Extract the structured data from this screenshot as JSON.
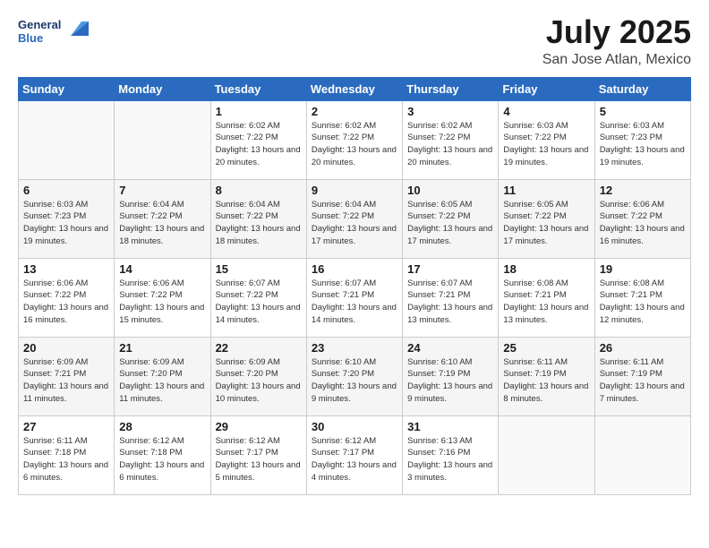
{
  "header": {
    "title": "July 2025",
    "location": "San Jose Atlan, Mexico"
  },
  "weekdays": [
    "Sunday",
    "Monday",
    "Tuesday",
    "Wednesday",
    "Thursday",
    "Friday",
    "Saturday"
  ],
  "days": [
    {
      "date": 1,
      "sunrise": "6:02 AM",
      "sunset": "7:22 PM",
      "daylight": "13 hours and 20 minutes."
    },
    {
      "date": 2,
      "sunrise": "6:02 AM",
      "sunset": "7:22 PM",
      "daylight": "13 hours and 20 minutes."
    },
    {
      "date": 3,
      "sunrise": "6:02 AM",
      "sunset": "7:22 PM",
      "daylight": "13 hours and 20 minutes."
    },
    {
      "date": 4,
      "sunrise": "6:03 AM",
      "sunset": "7:22 PM",
      "daylight": "13 hours and 19 minutes."
    },
    {
      "date": 5,
      "sunrise": "6:03 AM",
      "sunset": "7:23 PM",
      "daylight": "13 hours and 19 minutes."
    },
    {
      "date": 6,
      "sunrise": "6:03 AM",
      "sunset": "7:23 PM",
      "daylight": "13 hours and 19 minutes."
    },
    {
      "date": 7,
      "sunrise": "6:04 AM",
      "sunset": "7:22 PM",
      "daylight": "13 hours and 18 minutes."
    },
    {
      "date": 8,
      "sunrise": "6:04 AM",
      "sunset": "7:22 PM",
      "daylight": "13 hours and 18 minutes."
    },
    {
      "date": 9,
      "sunrise": "6:04 AM",
      "sunset": "7:22 PM",
      "daylight": "13 hours and 17 minutes."
    },
    {
      "date": 10,
      "sunrise": "6:05 AM",
      "sunset": "7:22 PM",
      "daylight": "13 hours and 17 minutes."
    },
    {
      "date": 11,
      "sunrise": "6:05 AM",
      "sunset": "7:22 PM",
      "daylight": "13 hours and 17 minutes."
    },
    {
      "date": 12,
      "sunrise": "6:06 AM",
      "sunset": "7:22 PM",
      "daylight": "13 hours and 16 minutes."
    },
    {
      "date": 13,
      "sunrise": "6:06 AM",
      "sunset": "7:22 PM",
      "daylight": "13 hours and 16 minutes."
    },
    {
      "date": 14,
      "sunrise": "6:06 AM",
      "sunset": "7:22 PM",
      "daylight": "13 hours and 15 minutes."
    },
    {
      "date": 15,
      "sunrise": "6:07 AM",
      "sunset": "7:22 PM",
      "daylight": "13 hours and 14 minutes."
    },
    {
      "date": 16,
      "sunrise": "6:07 AM",
      "sunset": "7:21 PM",
      "daylight": "13 hours and 14 minutes."
    },
    {
      "date": 17,
      "sunrise": "6:07 AM",
      "sunset": "7:21 PM",
      "daylight": "13 hours and 13 minutes."
    },
    {
      "date": 18,
      "sunrise": "6:08 AM",
      "sunset": "7:21 PM",
      "daylight": "13 hours and 13 minutes."
    },
    {
      "date": 19,
      "sunrise": "6:08 AM",
      "sunset": "7:21 PM",
      "daylight": "13 hours and 12 minutes."
    },
    {
      "date": 20,
      "sunrise": "6:09 AM",
      "sunset": "7:21 PM",
      "daylight": "13 hours and 11 minutes."
    },
    {
      "date": 21,
      "sunrise": "6:09 AM",
      "sunset": "7:20 PM",
      "daylight": "13 hours and 11 minutes."
    },
    {
      "date": 22,
      "sunrise": "6:09 AM",
      "sunset": "7:20 PM",
      "daylight": "13 hours and 10 minutes."
    },
    {
      "date": 23,
      "sunrise": "6:10 AM",
      "sunset": "7:20 PM",
      "daylight": "13 hours and 9 minutes."
    },
    {
      "date": 24,
      "sunrise": "6:10 AM",
      "sunset": "7:19 PM",
      "daylight": "13 hours and 9 minutes."
    },
    {
      "date": 25,
      "sunrise": "6:11 AM",
      "sunset": "7:19 PM",
      "daylight": "13 hours and 8 minutes."
    },
    {
      "date": 26,
      "sunrise": "6:11 AM",
      "sunset": "7:19 PM",
      "daylight": "13 hours and 7 minutes."
    },
    {
      "date": 27,
      "sunrise": "6:11 AM",
      "sunset": "7:18 PM",
      "daylight": "13 hours and 6 minutes."
    },
    {
      "date": 28,
      "sunrise": "6:12 AM",
      "sunset": "7:18 PM",
      "daylight": "13 hours and 6 minutes."
    },
    {
      "date": 29,
      "sunrise": "6:12 AM",
      "sunset": "7:17 PM",
      "daylight": "13 hours and 5 minutes."
    },
    {
      "date": 30,
      "sunrise": "6:12 AM",
      "sunset": "7:17 PM",
      "daylight": "13 hours and 4 minutes."
    },
    {
      "date": 31,
      "sunrise": "6:13 AM",
      "sunset": "7:16 PM",
      "daylight": "13 hours and 3 minutes."
    }
  ]
}
